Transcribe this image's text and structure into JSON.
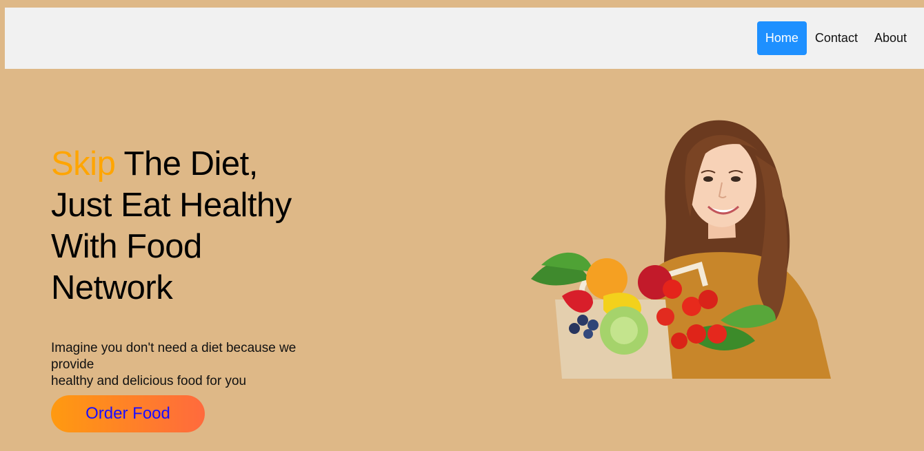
{
  "nav": {
    "items": [
      {
        "label": "Home",
        "active": true
      },
      {
        "label": "Contact",
        "active": false
      },
      {
        "label": "About",
        "active": false
      }
    ],
    "active_color": "#1e90ff"
  },
  "hero": {
    "headline_accent": "Skip",
    "headline_line1_rest": " The Diet,",
    "headline_line2": "Just Eat Healthy",
    "headline_line3": "With Food",
    "headline_line4": "Network",
    "subtext_line1": "Imagine you don't need a diet because we provide",
    "subtext_line2": "healthy and delicious food for you",
    "cta_label": "Order Food",
    "image_icon": "woman-with-vegetable-bag"
  },
  "colors": {
    "background": "#deb887",
    "accent": "#ffa500",
    "navbar_bg": "#f1f1f1"
  }
}
